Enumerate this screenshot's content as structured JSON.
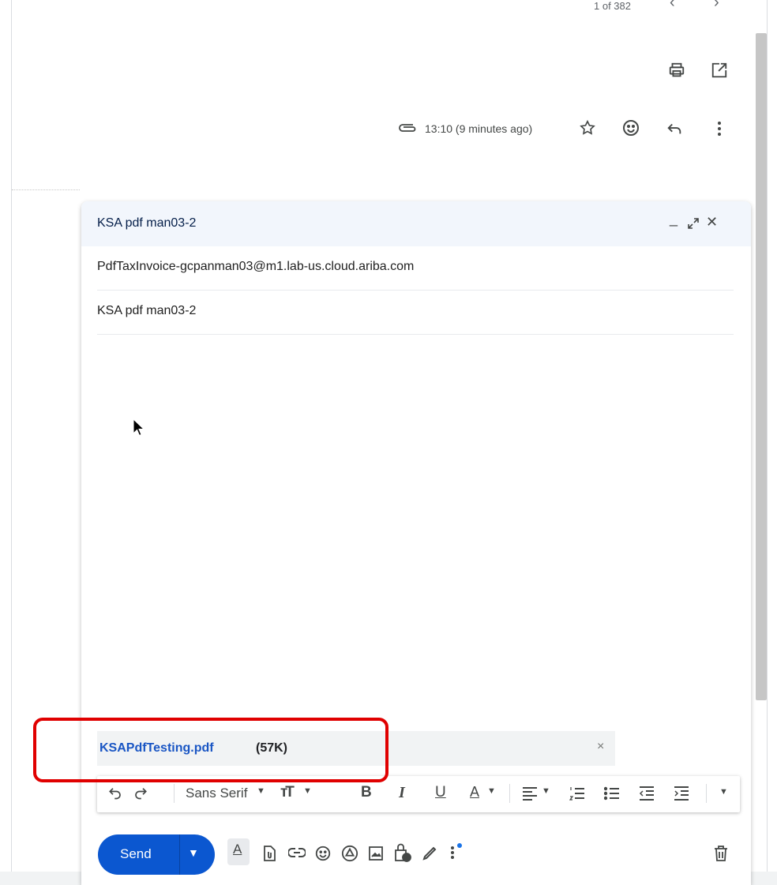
{
  "thread": {
    "pagination": "1 of 382",
    "time": "13:10 (9 minutes ago)"
  },
  "compose": {
    "title": "KSA pdf man03-2",
    "to": "PdfTaxInvoice-gcpanman03@m1.lab-us.cloud.ariba.com",
    "subject": "KSA pdf man03-2",
    "attachment": {
      "name": "KSAPdfTesting.pdf",
      "size": "(57K)"
    },
    "toolbar": {
      "font": "Sans Serif"
    },
    "send_label": "Send"
  },
  "colors": {
    "accent": "#0b57d0",
    "highlight": "#e00000",
    "link": "#1a56c4",
    "header_bg": "#f2f6fc"
  }
}
